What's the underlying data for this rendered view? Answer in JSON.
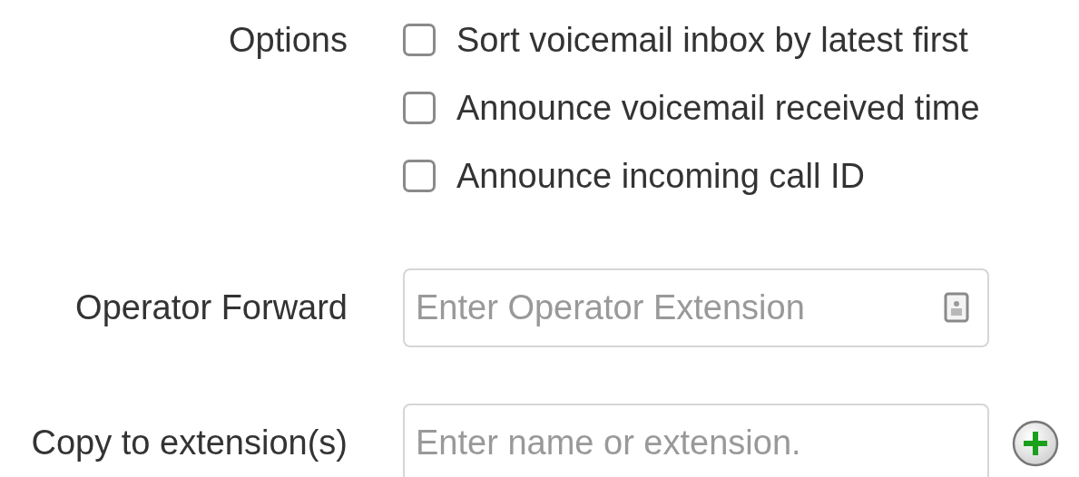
{
  "options": {
    "label": "Options",
    "items": [
      {
        "label": "Sort voicemail inbox by latest first",
        "checked": false
      },
      {
        "label": "Announce voicemail received time",
        "checked": false
      },
      {
        "label": "Announce incoming call ID",
        "checked": false
      }
    ]
  },
  "operator_forward": {
    "label": "Operator Forward",
    "placeholder": "Enter Operator Extension"
  },
  "copy_to": {
    "label": "Copy to extension(s)",
    "placeholder": "Enter name or extension."
  }
}
